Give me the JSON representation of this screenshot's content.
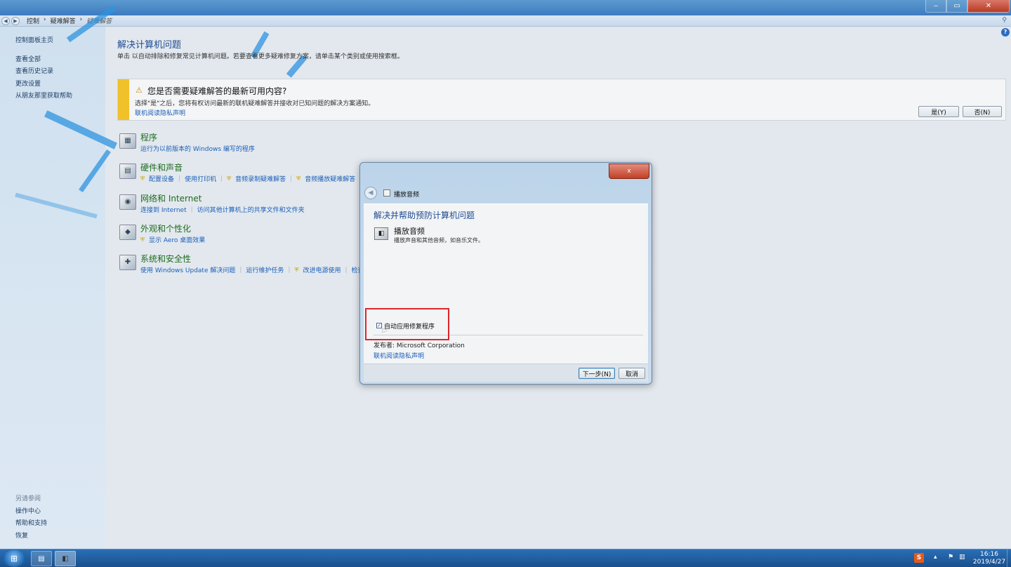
{
  "window": {
    "minimize_label": "‒",
    "maximize_label": "▭",
    "close_label": "✕"
  },
  "address": {
    "crumbs": [
      "控制",
      "疑难解答",
      "疑难解答"
    ],
    "back_glyph": "◀",
    "forward_glyph": "▶"
  },
  "leftnav": {
    "home": "控制面板主页",
    "links": [
      "查看全部",
      "查看历史记录",
      "更改设置",
      "从朋友那里获取帮助"
    ],
    "see_also_header": "另请参阅",
    "see_also": [
      "操作中心",
      "帮助和支持",
      "恢复"
    ]
  },
  "main": {
    "title": "解决计算机问题",
    "description": "单击      以自动排除和修复常见计算机问题。若要查看更多疑难修复方案，请单击某个类别或使用搜索框。",
    "banner": {
      "title": "您是否需要疑难解答的最新可用内容?",
      "text": "选择\"是\"之后，您将有权访问最新的联机疑难解答并接收对已知问题的解决方案通知。",
      "link": "联机阅读隐私声明",
      "yes": "是(Y)",
      "no": "否(N)"
    },
    "categories": [
      {
        "title": "程序",
        "links": [
          "运行为以前版本的 Windows 编写的程序"
        ]
      },
      {
        "title": "硬件和声音",
        "links": [
          "配置设备",
          "使用打印机",
          "音频录制疑难解答",
          "音频播放疑难解答"
        ]
      },
      {
        "title": "网络和 Internet",
        "links": [
          "连接到 Internet",
          "访问其他计算机上的共享文件和文件夹"
        ]
      },
      {
        "title": "外观和个性化",
        "links": [
          "显示 Aero 桌面效果"
        ]
      },
      {
        "title": "系统和安全性",
        "links": [
          "使用 Windows Update 解决问题",
          "运行维护任务",
          "改进电源使用",
          "检查"
        ]
      }
    ]
  },
  "dialog": {
    "close_label": "x",
    "title": "播放音频",
    "heading": "解决并帮助预防计算机问题",
    "item_title": "播放音频",
    "item_desc": "播放声音和其他音频，如音乐文件。",
    "checkbox_label": "自动应用修复程序",
    "checkbox_checked": true,
    "publisher": "发布者:  Microsoft Corporation",
    "privacy_link": "联机阅读隐私声明",
    "next": "下一步(N)",
    "cancel": "取消"
  },
  "taskbar": {
    "clock_time": "16:16",
    "clock_date": "2019/4/27",
    "sogou": "S"
  },
  "colors": {
    "link": "#1c5fb8",
    "title_blue": "#1e4b91",
    "category_green": "#1f6b1f",
    "highlight_red": "#e0252b",
    "banner_yellow": "#f1c12a"
  }
}
